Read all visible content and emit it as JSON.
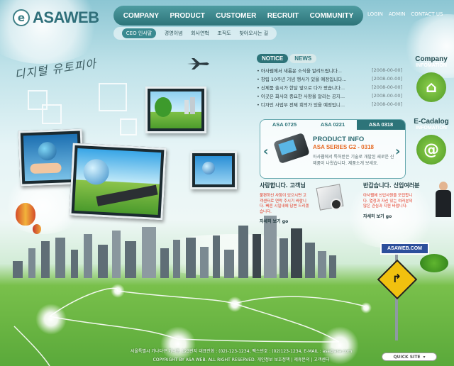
{
  "brand": {
    "logo_mark": "e",
    "logo_text": "ASAWEB"
  },
  "main_nav": [
    "COMPANY",
    "PRODUCT",
    "CUSTOMER",
    "RECRUIT",
    "COMMUNITY"
  ],
  "util_nav": [
    "LOGIN",
    "ADMIN",
    "CONTACT US"
  ],
  "sub_nav": [
    "CEO 인사말",
    "경영이념",
    "회사연혁",
    "조직도",
    "찾아오시는 길"
  ],
  "slogan": "디지털 유토피아",
  "notice": {
    "tab_notice": "NOTICE",
    "tab_news": "NEWS",
    "items": [
      {
        "title": "아사웹에서 새롭운 소식을 알려드립니다...",
        "date": "[2008-00-00]"
      },
      {
        "title": "창립 10주년 기념 행사가 있을 예정입니다...",
        "date": "[2008-00-00]"
      },
      {
        "title": "신제품 출시가 한달 앞으로 다가 왔습니다...",
        "date": "[2008-00-00]"
      },
      {
        "title": "이곳은 회사의 중요한 사항을 알리는 공지...",
        "date": "[2008-00-00]"
      },
      {
        "title": "디자인 사업부 전체 회의가 있을 예정입니...",
        "date": "[2008-00-00]"
      }
    ]
  },
  "product": {
    "tabs": [
      "ASA 0725",
      "ASA 0221",
      "ASA 0318"
    ],
    "title": "PRODUCT INFO",
    "subtitle": "ASA SERIES G2 - 0318",
    "desc": "아사웹에서 특허받은 기술로 개발된 새로운 신제품이 나왔습니다. 제품소개 보세요."
  },
  "love": {
    "title": "사랑합니다. 고객님",
    "text": "불편하신 사항이 있으시면 고객센터로 연락 주시기 바랍니다. 빠른 시일내에 답변 드리겠습니다.",
    "more": "자세히 보기 go"
  },
  "welcome": {
    "title": "반갑습니다. 신입여러분",
    "text": "아사웹에 신입사원을 모집합니다. 열정과 자신 있는 여러분의 많은 관심과 지원 바랍니다.",
    "more": "자세히 보기 go"
  },
  "right": {
    "company_title": "Company",
    "company_sub": "INFOMATION",
    "catalog_title": "E-Cadalog",
    "catalog_sub": "INFOMATION"
  },
  "sign": "ASAWEB.COM",
  "footer": {
    "line1": "서울특별시 가나다구 가나동 123번지 대표전화 : (02)-123-1234, 팩스번호 : (02)123-1234, E-MAIL : asa@asa.com",
    "line2": "COPYRIGHT BY ASA WEB. ALL RIGHT RESERVED.  개인정보 보호정책 | 제휴문의 | 고객센터"
  },
  "quick_site": "QUICK SITE",
  "colors": {
    "nav": "#2d7479",
    "accent": "#e66a24",
    "grass": "#5aa93a"
  }
}
